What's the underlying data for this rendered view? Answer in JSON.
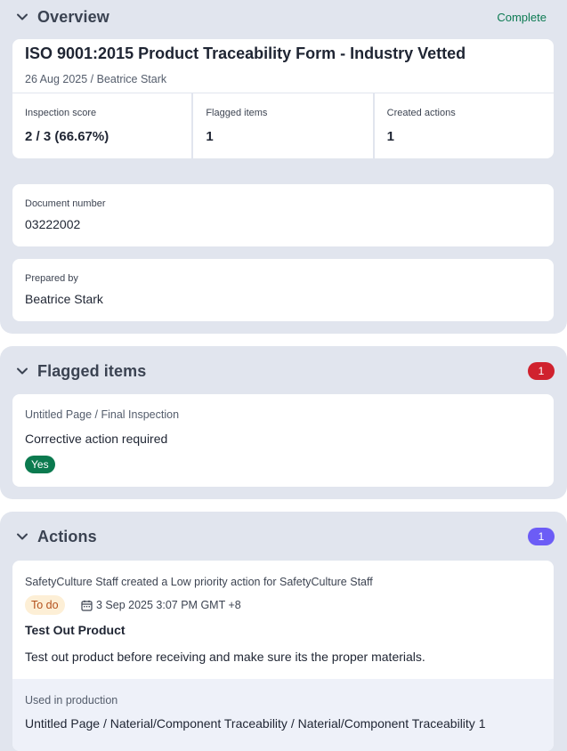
{
  "overview": {
    "title": "Overview",
    "status": "Complete",
    "status_color": "#0c7a52",
    "chevron_icon": "chevron-down-icon",
    "document_title": "ISO 9001:2015 Product Traceability Form - Industry Vetted",
    "subtitle": "26 Aug 2025 / Beatrice Stark",
    "stats": [
      {
        "label": "Inspection score",
        "value": "2 / 3 (66.67%)"
      },
      {
        "label": "Flagged items",
        "value": "1"
      },
      {
        "label": "Created actions",
        "value": "1"
      }
    ],
    "fields": [
      {
        "label": "Document number",
        "value": "03222002"
      },
      {
        "label": "Prepared by",
        "value": "Beatrice Stark"
      }
    ]
  },
  "flagged": {
    "title": "Flagged items",
    "count": "1",
    "count_color": "#d0222e",
    "item": {
      "path": "Untitled Page / Final Inspection",
      "question": "Corrective action required",
      "answer": "Yes",
      "answer_color": "#0b7a4f"
    }
  },
  "actions": {
    "title": "Actions",
    "count": "1",
    "count_color": "#6c5cf6",
    "item": {
      "meta": "SafetyCulture Staff created a Low priority action for SafetyCulture Staff",
      "status": "To do",
      "date_icon": "calendar-icon",
      "date": "3 Sep 2025 3:07 PM GMT +8",
      "title": "Test Out Product",
      "description": "Test out product before receiving and make sure its the proper materials.",
      "used_in_label": "Used in production",
      "used_in_path": "Untitled Page / Naterial/Component Traceability / Naterial/Component Traceability 1"
    }
  }
}
